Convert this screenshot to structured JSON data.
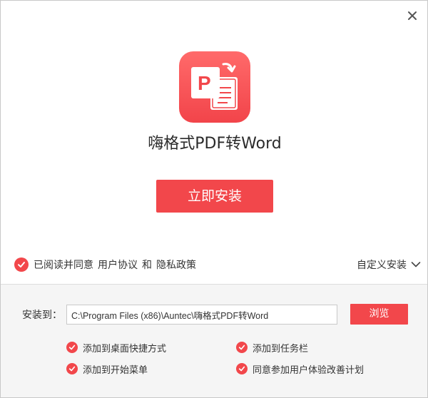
{
  "app": {
    "title": "嗨格式PDF转Word",
    "logo_icon": "pdf-to-word-icon",
    "logo_letter": "P"
  },
  "colors": {
    "accent": "#f2474b",
    "logo_gradient_top": "#ff6a6a",
    "panel_bg": "#f5f5f5"
  },
  "install_button": {
    "label": "立即安装"
  },
  "agreement": {
    "checked": true,
    "prefix": "已阅读并同意",
    "user_agreement": "用户协议",
    "and": "和",
    "privacy_policy": "隐私政策"
  },
  "custom_install": {
    "label": "自定义安装",
    "icon": "chevron-down-icon"
  },
  "install_path": {
    "label": "安装到：",
    "value": "C:\\Program Files (x86)\\Auntec\\嗨格式PDF转Word",
    "browse_label": "浏览"
  },
  "options": [
    {
      "label": "添加到桌面快捷方式",
      "checked": true
    },
    {
      "label": "添加到任务栏",
      "checked": true
    },
    {
      "label": "添加到开始菜单",
      "checked": true
    },
    {
      "label": "同意参加用户体验改善计划",
      "checked": true
    }
  ]
}
